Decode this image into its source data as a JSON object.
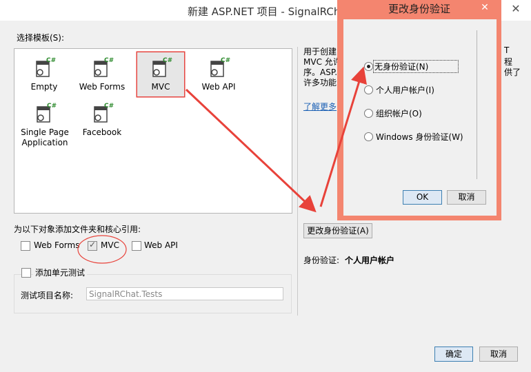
{
  "window": {
    "title": "新建 ASP.NET 项目 - SignalRChat",
    "close_symbol": "✕"
  },
  "templates": {
    "label": "选择模板(S):",
    "items": [
      {
        "name": "Empty"
      },
      {
        "name": "Web Forms"
      },
      {
        "name": "MVC"
      },
      {
        "name": "Web API"
      },
      {
        "name": "Single Page Application"
      },
      {
        "name": "Facebook"
      }
    ],
    "selected": "MVC",
    "icon_badge": "C#"
  },
  "folders": {
    "label": "为以下对象添加文件夹和核心引用:",
    "options": [
      {
        "label": "Web Forms",
        "checked": false
      },
      {
        "label": "MVC",
        "checked": true
      },
      {
        "label": "Web API",
        "checked": false
      }
    ]
  },
  "unit_test": {
    "label": "添加单元测试",
    "checked": false,
    "project_name_label": "测试项目名称:",
    "project_name_value": "SignalRChat.Tests"
  },
  "description": {
    "line1_left": "用于创建",
    "line1_right": "T",
    "line2_left": "MVC 允许",
    "line2_right": "程",
    "line3_left": "序。ASP.",
    "line3_right": "供了",
    "line4_left": "许多功能",
    "learn_more": "了解更多"
  },
  "auth": {
    "change_button": "更改身份验证(A)",
    "label": "身份验证:",
    "value": "个人用户帐户"
  },
  "footer": {
    "ok": "确定",
    "cancel": "取消"
  },
  "dialog": {
    "title": "更改身份验证",
    "options": [
      {
        "label": "无身份验证(N)",
        "selected": true
      },
      {
        "label": "个人用户帐户(I)",
        "selected": false
      },
      {
        "label": "组织帐户(O)",
        "selected": false
      },
      {
        "label": "Windows 身份验证(W)",
        "selected": false
      }
    ],
    "ok": "OK",
    "cancel": "取消"
  },
  "colors": {
    "annotation_red": "#e8423a",
    "dialog_frame": "#f4856f",
    "link": "#1a5fb4"
  }
}
